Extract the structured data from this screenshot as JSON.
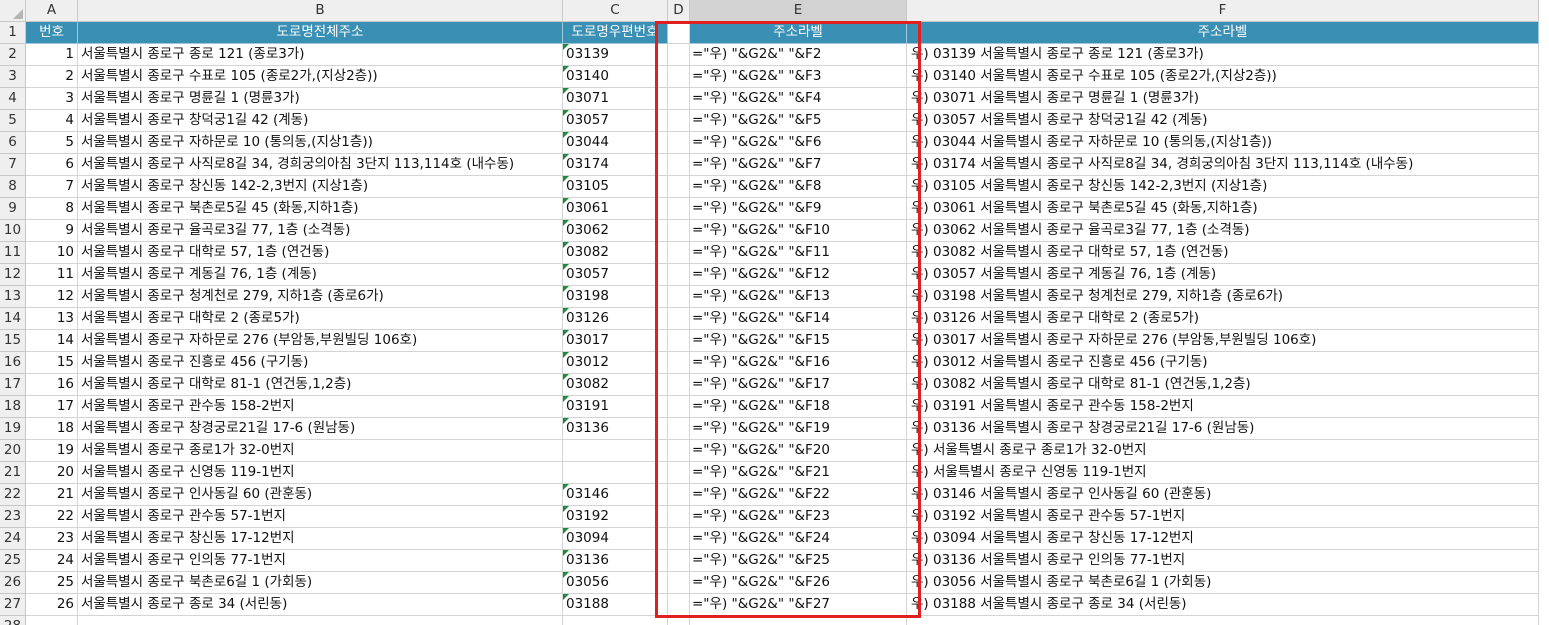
{
  "columns": [
    "A",
    "B",
    "C",
    "D",
    "E",
    "F"
  ],
  "row_numbers": [
    "1",
    "2",
    "3",
    "4",
    "5",
    "6",
    "7",
    "8",
    "9",
    "10",
    "11",
    "12",
    "13",
    "14",
    "15",
    "16",
    "17",
    "18",
    "19",
    "20",
    "21",
    "22",
    "23",
    "24",
    "25",
    "26",
    "27",
    "28"
  ],
  "headers": {
    "a": "번호",
    "b": "도로명전체주소",
    "c": "도로명우편번호",
    "d": "",
    "e": "주소라벨",
    "f": "주소라벨"
  },
  "rows": [
    {
      "num": "1",
      "addr": "서울특별시 종로구 종로 121 (종로3가)",
      "zip": "03139",
      "formula": "=\"우) \"&G2&\"   \"&F2",
      "label": "우) 03139  서울특별시 종로구 종로 121 (종로3가)"
    },
    {
      "num": "2",
      "addr": "서울특별시 종로구 수표로 105 (종로2가,(지상2층))",
      "zip": "03140",
      "formula": "=\"우) \"&G2&\"   \"&F3",
      "label": "우) 03140  서울특별시 종로구 수표로 105 (종로2가,(지상2층))"
    },
    {
      "num": "3",
      "addr": "서울특별시 종로구 명륜길 1 (명륜3가)",
      "zip": "03071",
      "formula": "=\"우) \"&G2&\"   \"&F4",
      "label": "우) 03071  서울특별시 종로구 명륜길 1 (명륜3가)"
    },
    {
      "num": "4",
      "addr": "서울특별시 종로구 창덕궁1길 42 (계동)",
      "zip": "03057",
      "formula": "=\"우) \"&G2&\"   \"&F5",
      "label": "우) 03057  서울특별시 종로구 창덕궁1길 42 (계동)"
    },
    {
      "num": "5",
      "addr": "서울특별시 종로구 자하문로 10 (통의동,(지상1층))",
      "zip": "03044",
      "formula": "=\"우) \"&G2&\"   \"&F6",
      "label": "우) 03044  서울특별시 종로구 자하문로 10 (통의동,(지상1층))"
    },
    {
      "num": "6",
      "addr": "서울특별시 종로구 사직로8길 34, 경희궁의아침 3단지 113,114호 (내수동)",
      "zip": "03174",
      "formula": "=\"우) \"&G2&\"   \"&F7",
      "label": "우) 03174  서울특별시 종로구 사직로8길 34, 경희궁의아침 3단지 113,114호 (내수동)"
    },
    {
      "num": "7",
      "addr": "서울특별시 종로구 창신동 142-2,3번지 (지상1층)",
      "zip": "03105",
      "formula": "=\"우) \"&G2&\"   \"&F8",
      "label": "우) 03105  서울특별시 종로구 창신동 142-2,3번지 (지상1층)"
    },
    {
      "num": "8",
      "addr": "서울특별시 종로구 북촌로5길 45 (화동,지하1층)",
      "zip": "03061",
      "formula": "=\"우) \"&G2&\"   \"&F9",
      "label": "우) 03061  서울특별시 종로구 북촌로5길 45 (화동,지하1층)"
    },
    {
      "num": "9",
      "addr": "서울특별시 종로구 율곡로3길 77, 1층 (소격동)",
      "zip": "03062",
      "formula": "=\"우) \"&G2&\"   \"&F10",
      "label": "우) 03062  서울특별시 종로구 율곡로3길 77, 1층 (소격동)"
    },
    {
      "num": "10",
      "addr": "서울특별시 종로구 대학로 57, 1층 (연건동)",
      "zip": "03082",
      "formula": "=\"우) \"&G2&\"   \"&F11",
      "label": "우) 03082  서울특별시 종로구 대학로 57, 1층 (연건동)"
    },
    {
      "num": "11",
      "addr": "서울특별시 종로구 계동길 76, 1층 (계동)",
      "zip": "03057",
      "formula": "=\"우) \"&G2&\"   \"&F12",
      "label": "우) 03057  서울특별시 종로구 계동길 76, 1층 (계동)"
    },
    {
      "num": "12",
      "addr": "서울특별시 종로구 청계천로 279, 지하1층 (종로6가)",
      "zip": "03198",
      "formula": "=\"우) \"&G2&\"   \"&F13",
      "label": "우) 03198  서울특별시 종로구 청계천로 279, 지하1층 (종로6가)"
    },
    {
      "num": "13",
      "addr": "서울특별시 종로구 대학로 2 (종로5가)",
      "zip": "03126",
      "formula": "=\"우) \"&G2&\"   \"&F14",
      "label": "우) 03126  서울특별시 종로구 대학로 2 (종로5가)"
    },
    {
      "num": "14",
      "addr": "서울특별시 종로구 자하문로 276 (부암동,부원빌딩 106호)",
      "zip": "03017",
      "formula": "=\"우) \"&G2&\"   \"&F15",
      "label": "우) 03017  서울특별시 종로구 자하문로 276 (부암동,부원빌딩 106호)"
    },
    {
      "num": "15",
      "addr": "서울특별시 종로구 진흥로 456 (구기동)",
      "zip": "03012",
      "formula": "=\"우) \"&G2&\"   \"&F16",
      "label": "우) 03012  서울특별시 종로구 진흥로 456 (구기동)"
    },
    {
      "num": "16",
      "addr": "서울특별시 종로구 대학로 81-1 (연건동,1,2층)",
      "zip": "03082",
      "formula": "=\"우) \"&G2&\"   \"&F17",
      "label": "우) 03082  서울특별시 종로구 대학로 81-1 (연건동,1,2층)"
    },
    {
      "num": "17",
      "addr": "서울특별시 종로구 관수동 158-2번지",
      "zip": "03191",
      "formula": "=\"우) \"&G2&\"   \"&F18",
      "label": "우) 03191  서울특별시 종로구 관수동 158-2번지"
    },
    {
      "num": "18",
      "addr": "서울특별시 종로구 창경궁로21길 17-6 (원남동)",
      "zip": "03136",
      "formula": "=\"우) \"&G2&\"   \"&F19",
      "label": "우) 03136  서울특별시 종로구 창경궁로21길 17-6 (원남동)"
    },
    {
      "num": "19",
      "addr": "서울특별시 종로구 종로1가 32-0번지",
      "zip": "",
      "formula": "=\"우) \"&G2&\"   \"&F20",
      "label": "우)    서울특별시 종로구 종로1가 32-0번지"
    },
    {
      "num": "20",
      "addr": "서울특별시 종로구 신영동 119-1번지",
      "zip": "",
      "formula": "=\"우) \"&G2&\"   \"&F21",
      "label": "우)    서울특별시 종로구 신영동 119-1번지"
    },
    {
      "num": "21",
      "addr": "서울특별시 종로구 인사동길 60 (관훈동)",
      "zip": "03146",
      "formula": "=\"우) \"&G2&\"   \"&F22",
      "label": "우) 03146  서울특별시 종로구 인사동길 60 (관훈동)"
    },
    {
      "num": "22",
      "addr": "서울특별시 종로구 관수동 57-1번지",
      "zip": "03192",
      "formula": "=\"우) \"&G2&\"   \"&F23",
      "label": "우) 03192  서울특별시 종로구 관수동 57-1번지"
    },
    {
      "num": "23",
      "addr": "서울특별시 종로구 창신동 17-12번지",
      "zip": "03094",
      "formula": "=\"우) \"&G2&\"   \"&F24",
      "label": "우) 03094  서울특별시 종로구 창신동 17-12번지"
    },
    {
      "num": "24",
      "addr": "서울특별시 종로구 인의동 77-1번지",
      "zip": "03136",
      "formula": "=\"우) \"&G2&\"   \"&F25",
      "label": "우) 03136  서울특별시 종로구 인의동 77-1번지"
    },
    {
      "num": "25",
      "addr": "서울특별시 종로구 북촌로6길 1 (가회동)",
      "zip": "03056",
      "formula": "=\"우) \"&G2&\"   \"&F26",
      "label": "우) 03056  서울특별시 종로구 북촌로6길 1 (가회동)"
    },
    {
      "num": "26",
      "addr": "서울특별시 종로구 종로 34 (서린동)",
      "zip": "03188",
      "formula": "=\"우) \"&G2&\"   \"&F27",
      "label": "우) 03188  서울특별시 종로구 종로 34 (서린동)"
    }
  ]
}
